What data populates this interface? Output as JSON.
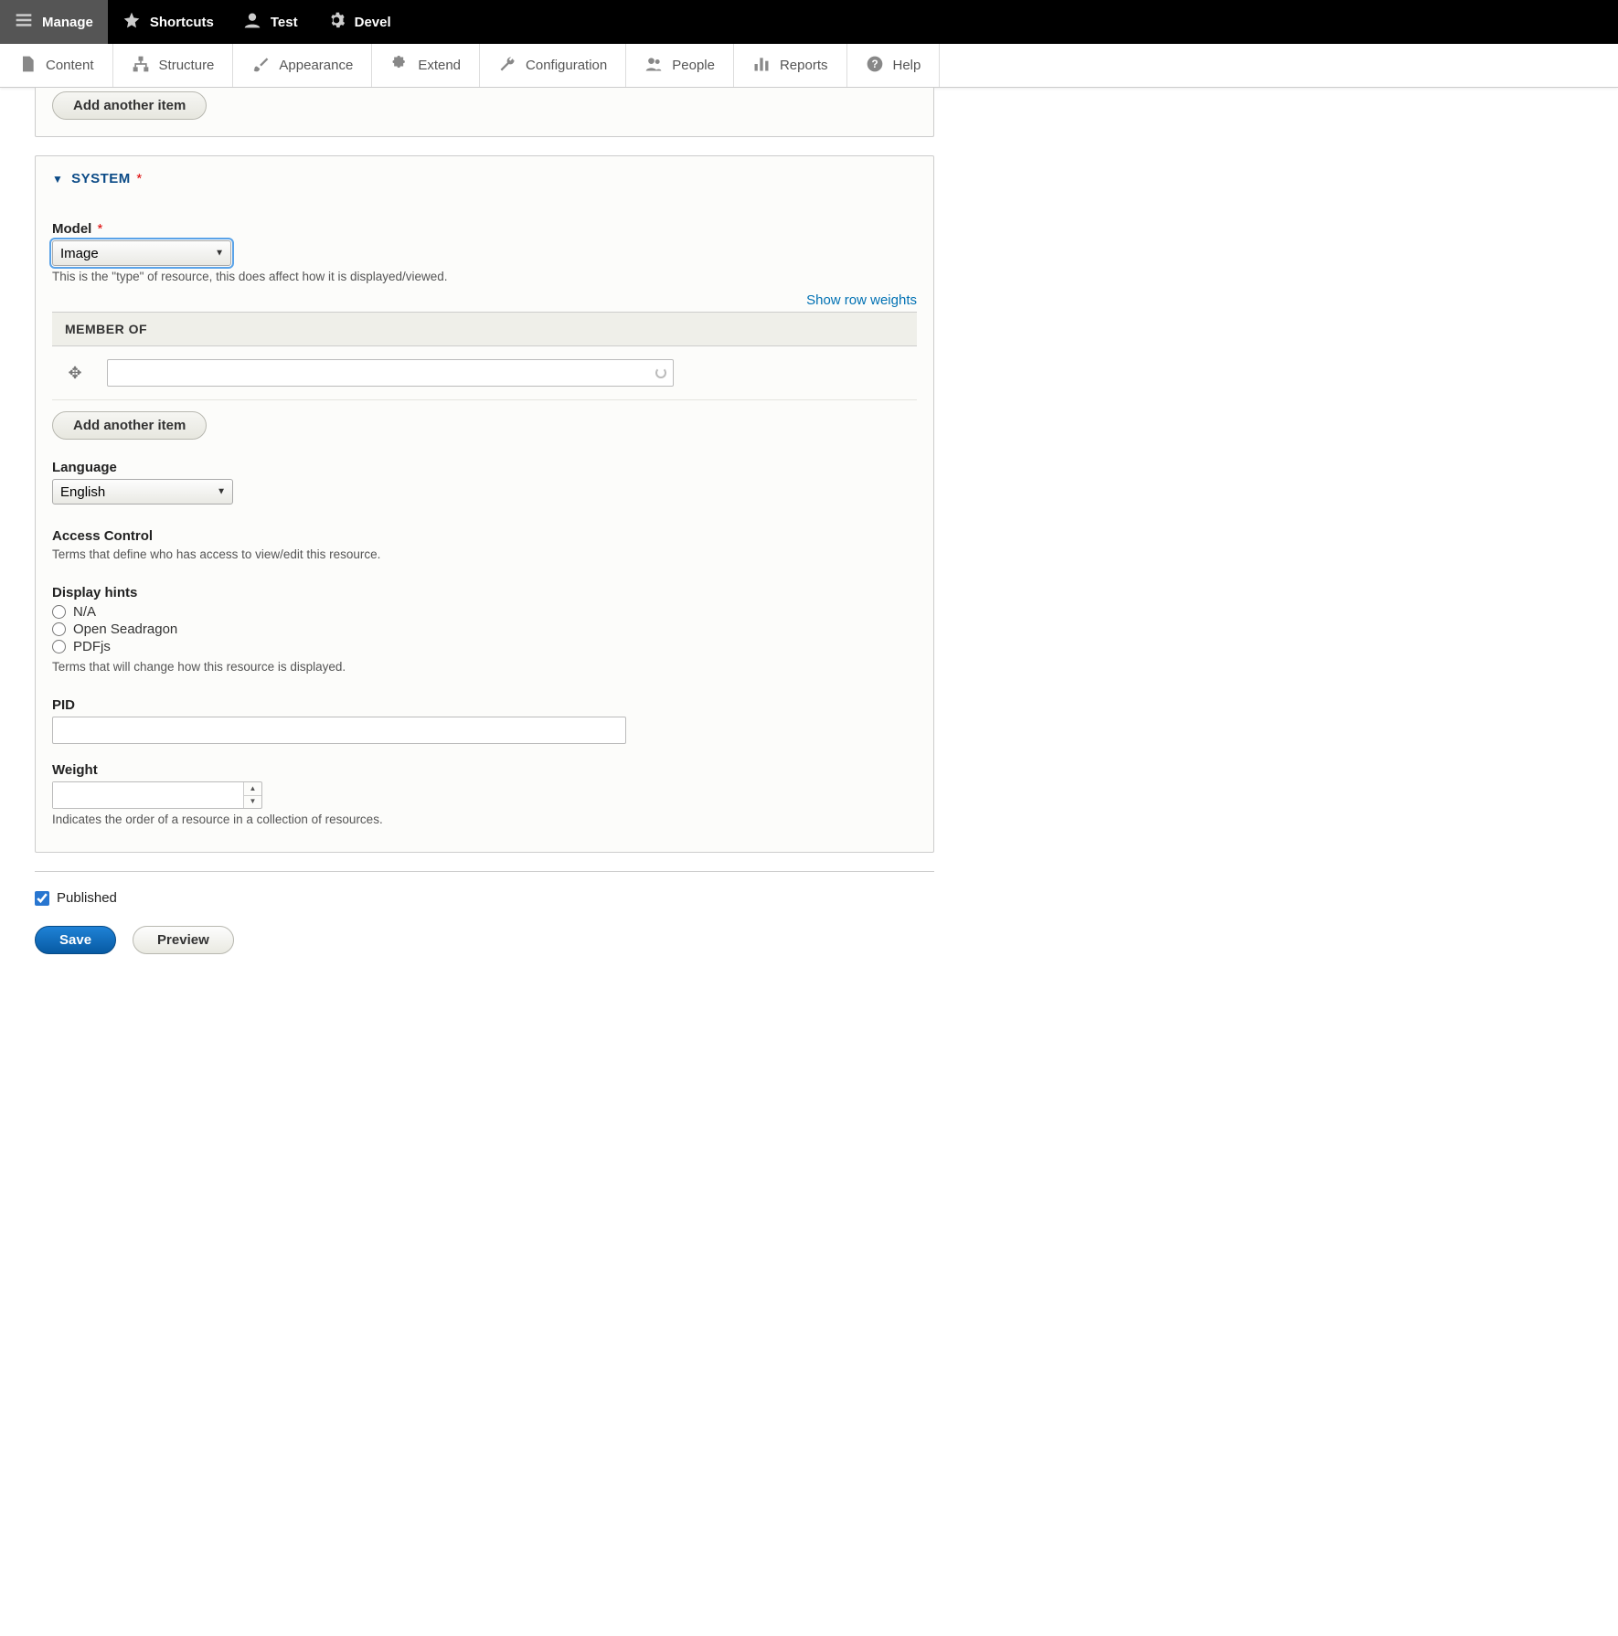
{
  "toolbar_top": {
    "manage": "Manage",
    "shortcuts": "Shortcuts",
    "user": "Test",
    "devel": "Devel"
  },
  "toolbar_sub": {
    "content": "Content",
    "structure": "Structure",
    "appearance": "Appearance",
    "extend": "Extend",
    "configuration": "Configuration",
    "people": "People",
    "reports": "Reports",
    "help": "Help"
  },
  "panel1": {
    "add_another": "Add another item"
  },
  "system": {
    "title": "SYSTEM",
    "model": {
      "label": "Model",
      "value": "Image",
      "description": "This is the \"type\" of resource, this does affect how it is displayed/viewed."
    },
    "show_row_weights": "Show row weights",
    "member_of": {
      "header": "MEMBER OF",
      "value": ""
    },
    "add_another": "Add another item",
    "language": {
      "label": "Language",
      "value": "English"
    },
    "access_control": {
      "label": "Access Control",
      "description": "Terms that define who has access to view/edit this resource."
    },
    "display_hints": {
      "label": "Display hints",
      "options": [
        "N/A",
        "Open Seadragon",
        "PDFjs"
      ],
      "description": "Terms that will change how this resource is displayed."
    },
    "pid": {
      "label": "PID",
      "value": ""
    },
    "weight": {
      "label": "Weight",
      "value": "",
      "description": "Indicates the order of a resource in a collection of resources."
    }
  },
  "published": {
    "label": "Published",
    "checked": true
  },
  "actions": {
    "save": "Save",
    "preview": "Preview"
  }
}
